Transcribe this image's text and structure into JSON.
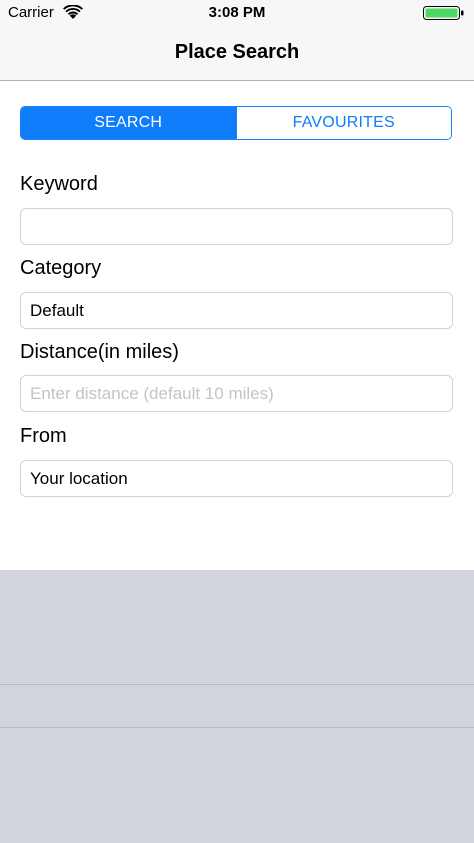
{
  "status_bar": {
    "carrier": "Carrier",
    "time": "3:08 PM",
    "wifi_icon": "wifi-icon",
    "battery_icon": "battery-icon",
    "battery_color": "#4cd964"
  },
  "nav": {
    "title": "Place Search"
  },
  "segments": {
    "search_label": "SEARCH",
    "favourites_label": "FAVOURITES",
    "active": "SEARCH",
    "accent_color": "#0e7cfb"
  },
  "form": {
    "keyword": {
      "label": "Keyword",
      "value": "",
      "placeholder": ""
    },
    "category": {
      "label": "Category",
      "value": "Default"
    },
    "distance": {
      "label": "Distance(in miles)",
      "value": "",
      "placeholder": "Enter distance (default 10 miles)"
    },
    "from": {
      "label": "From",
      "value": "Your location"
    }
  }
}
